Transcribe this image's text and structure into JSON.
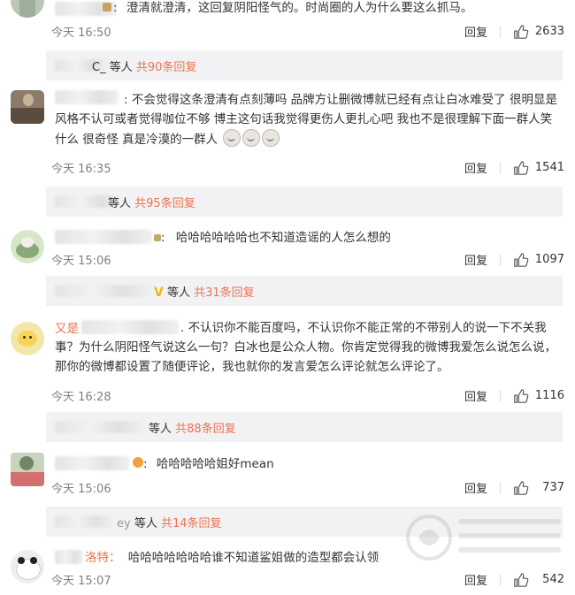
{
  "comments": [
    {
      "text": "澄清就澄清，这回复阴阳怪气的。时尚圈的人为什么要这么抓马。",
      "time": "今天 16:50",
      "reply_label": "回复",
      "likes": "2633"
    },
    {
      "text": "不会觉得这条澄清有点刻薄吗 品牌方让删微博就已经有点让白冰难受了 很明显是风格不认可或者觉得咖位不够 博主这句话我觉得更伤人更扎心吧 我也不是很理解下面一群人笑什么 很奇怪 真是冷漠的一群人",
      "time": "今天 16:35",
      "reply_label": "回复",
      "likes": "1541"
    },
    {
      "text": "哈哈哈哈哈哈也不知道造谣的人怎么想的",
      "time": "今天 15:06",
      "reply_label": "回复",
      "likes": "1097"
    },
    {
      "name_visible": "又是",
      "text": "不认识你不能百度吗，不认识你不能正常的不带别人的说一下不关我事？为什么阴阳怪气说这么一句？白冰也是公众人物。你肯定觉得我的微博我爱怎么说怎么说，那你的微博都设置了随便评论，我也就你的发言爱怎么评论就怎么评论了。",
      "time": "今天 16:28",
      "reply_label": "回复",
      "likes": "1116"
    },
    {
      "text": "哈哈哈哈哈姐好mean",
      "time": "今天 15:06",
      "reply_label": "回复",
      "likes": "737"
    },
    {
      "name_visible": "洛特：",
      "text": "哈哈哈哈哈哈哈谁不知道鲨姐做的造型都会认领",
      "time": "今天 15:07",
      "reply_label": "回复",
      "likes": "542"
    }
  ],
  "replies": [
    {
      "name_tail": "C_",
      "label": " 等人",
      "count": "共90条回复"
    },
    {
      "name_tail": "等人",
      "label": "",
      "count": "共95条回复"
    },
    {
      "name_tail": "",
      "label": " 等人",
      "count": "共31条回复"
    },
    {
      "name_tail": "",
      "label": "等人",
      "count": "共88条回复"
    },
    {
      "name_tail": "ey",
      "label": " 等人",
      "count": "共14条回复"
    }
  ],
  "colors": {
    "accent": "#eb7350",
    "reply_bg": "#f2f2f5",
    "meta": "#808080"
  },
  "icons": {
    "like": "thumbs-up-icon"
  }
}
